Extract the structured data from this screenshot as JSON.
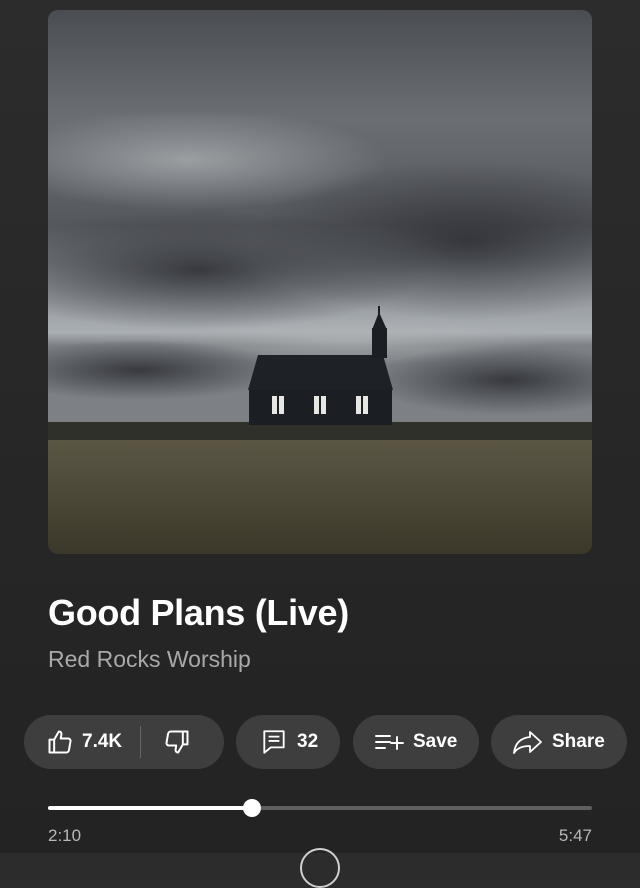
{
  "track": {
    "title": "Good Plans (Live)",
    "artist": "Red Rocks Worship",
    "artwork_description_icon": "album-art-image"
  },
  "actions": {
    "like_count": "7.4K",
    "comment_count": "32",
    "save_label": "Save",
    "share_label": "Share"
  },
  "playback": {
    "elapsed": "2:10",
    "total": "5:47",
    "progress_fraction": 0.375
  },
  "colors": {
    "background": "#2a2a2a",
    "pill": "#3e3e3e",
    "progress_track": "#5f5f5f",
    "progress_fill": "#ffffff",
    "secondary_text": "#a9a9a9"
  }
}
